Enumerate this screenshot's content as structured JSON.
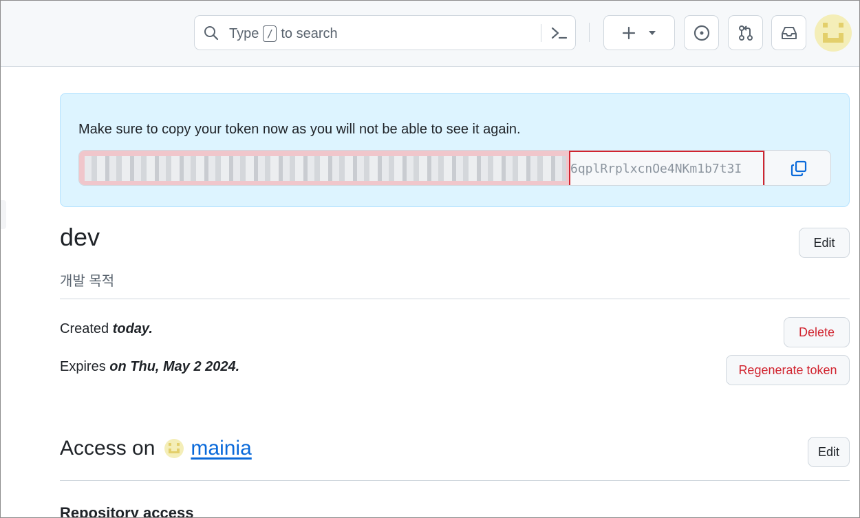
{
  "header": {
    "search_placeholder_before": "Type",
    "search_shortcut": "/",
    "search_placeholder_after": "to search",
    "colors": {
      "bg": "#f6f8fa",
      "border": "#d0d7de"
    }
  },
  "flash": {
    "message": "Make sure to copy your token now as you will not be able to see it again.",
    "token_visible_fragment": "6qplRrplxcnOe4NKm1b7t3I",
    "highlight_color": "#d1242f"
  },
  "token": {
    "name": "dev",
    "description": "개발 목적",
    "edit_label": "Edit",
    "created_prefix": "Created",
    "created_value": "today.",
    "expires_prefix": "Expires",
    "expires_value": "on Thu, May 2 2024.",
    "delete_label": "Delete",
    "regenerate_label": "Regenerate token"
  },
  "access": {
    "prefix": "Access on",
    "owner": "mainia",
    "edit_label": "Edit",
    "repository_heading": "Repository access"
  }
}
